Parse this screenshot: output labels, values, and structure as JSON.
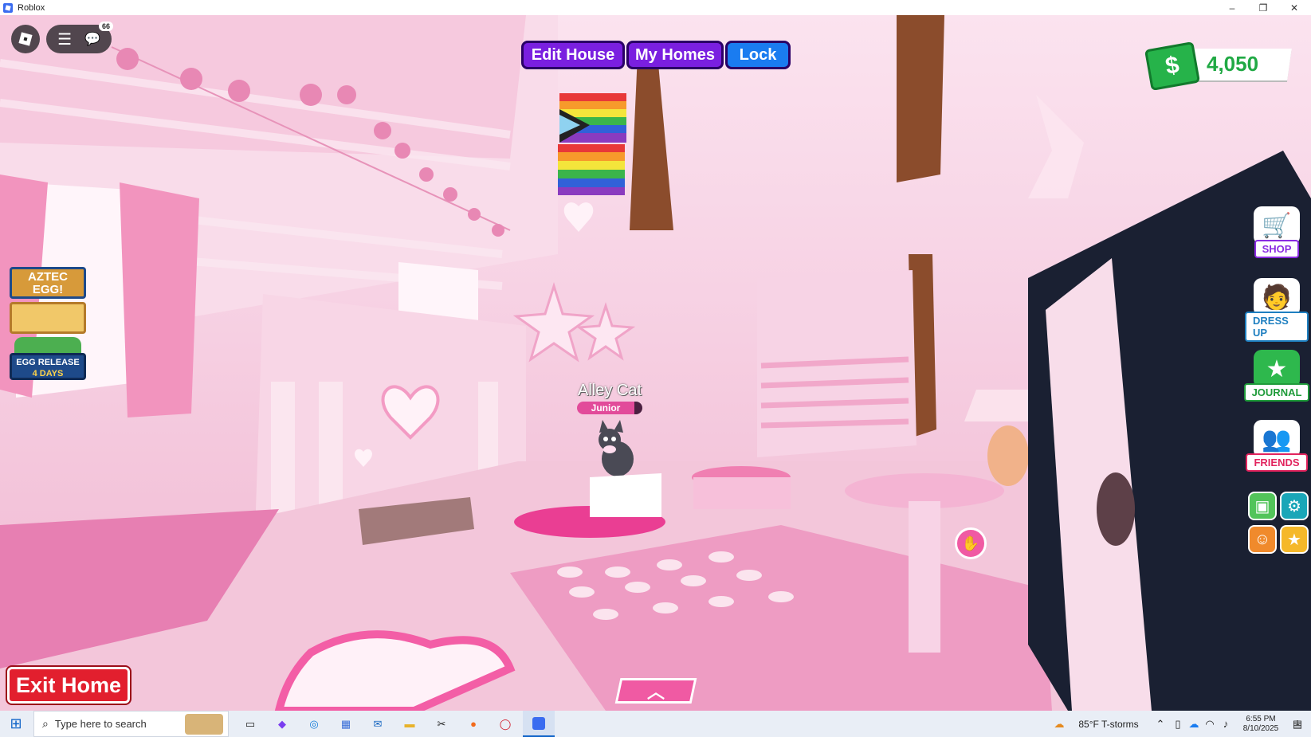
{
  "window": {
    "title": "Roblox",
    "controls": [
      "–",
      "❐",
      "✕"
    ]
  },
  "hud": {
    "chat_badge": "66",
    "tabs": [
      "Edit House",
      "My Homes",
      "Lock"
    ],
    "money": "4,050",
    "money_symbol": "$",
    "side_buttons": [
      "SHOP",
      "DRESS UP",
      "JOURNAL",
      "FRIENDS"
    ],
    "aztec_sign": {
      "line1": "AZTEC",
      "line2": "EGG!",
      "line3": "EGG RELEASE",
      "line4": "4 DAYS"
    },
    "player": {
      "name": "Alley Cat",
      "rank": "Junior"
    },
    "exit_button": "Exit Home"
  },
  "taskbar": {
    "search_placeholder": "Type here to search",
    "weather": "85°F  T-storms",
    "time": "6:55 PM",
    "date": "8/10/2025",
    "notif_count": "1"
  },
  "colors": {
    "edit_house": "#7a1fe0",
    "my_homes": "#7a1fe0",
    "lock": "#1a7cf0",
    "money_green": "#20a944",
    "exit_red": "#e21f2e",
    "accent_pink": "#f05aa3"
  }
}
